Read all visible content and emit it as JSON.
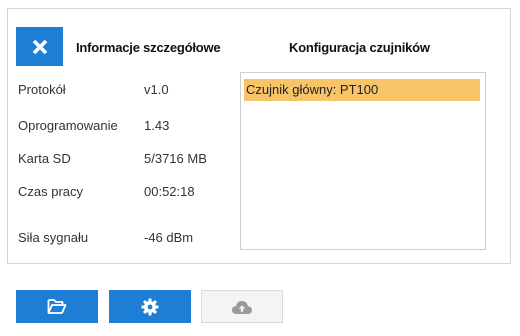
{
  "header": {
    "details_title": "Informacje szczegółowe",
    "sensors_title": "Konfiguracja czujników"
  },
  "details": [
    {
      "label": "Protokół",
      "value": "v1.0"
    },
    {
      "label": "Oprogramowanie",
      "value": "1.43"
    },
    {
      "label": "Karta SD",
      "value": "5/3716 MB"
    },
    {
      "label": "Czas pracy",
      "value": "00:52:18"
    },
    {
      "label": "Siła sygnału",
      "value": "-46 dBm"
    }
  ],
  "sensors": {
    "items": [
      "Czujnik główny: PT100"
    ],
    "selected_color": "#f7c46a"
  },
  "toolbar": {
    "buttons": [
      {
        "icon": "folder-open-icon",
        "enabled": true
      },
      {
        "icon": "gear-icon",
        "enabled": true
      },
      {
        "icon": "cloud-upload-icon",
        "enabled": false
      }
    ]
  },
  "colors": {
    "accent": "#1e7ed6",
    "disabled_bg": "#f4f4f4"
  }
}
